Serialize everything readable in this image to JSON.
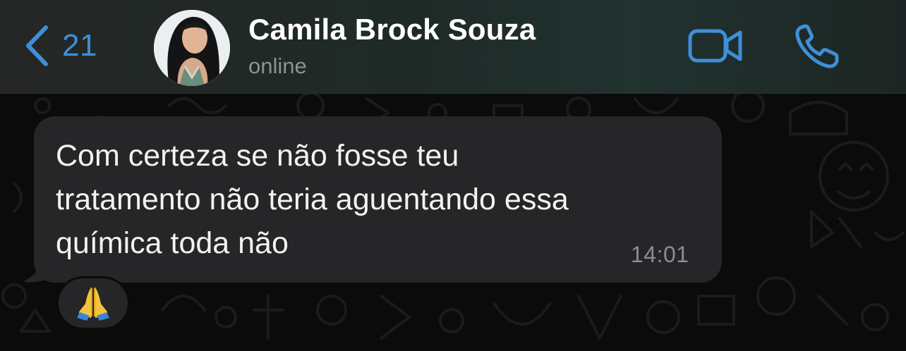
{
  "header": {
    "back_count": "21",
    "contact_name": "Camila Brock Souza",
    "status": "online",
    "back_icon": "chevron-left-icon",
    "video_icon": "video-camera-icon",
    "call_icon": "phone-icon"
  },
  "messages": [
    {
      "text": "Com certeza se não fosse teu\ntratamento não teria aguentando essa\nquímica toda não",
      "time": "14:01",
      "reaction": "folded-hands-emoji"
    }
  ],
  "colors": {
    "accent": "#3f8fd9",
    "bubble": "#262628",
    "background": "#0b0b0c"
  }
}
